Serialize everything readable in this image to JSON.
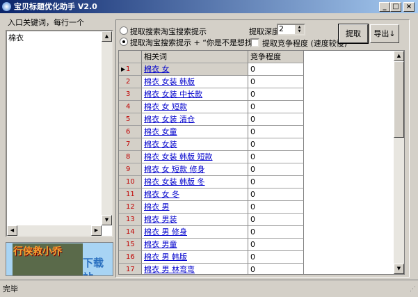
{
  "window": {
    "title": "宝贝标题优化助手 V2.0",
    "minimize": "_",
    "maximize": "□",
    "close": "×"
  },
  "left": {
    "label": "入口关键词，每行一个",
    "keywords": "棉衣",
    "banner_text": "行侠救小乔",
    "banner_side": "下载站"
  },
  "options": {
    "radio1": "提取搜索淘宝搜索提示",
    "radio2": "提取淘宝搜索提示 + “你是不是想找”",
    "selected": 2,
    "depth_label": "提取深度",
    "depth_value": "2",
    "checkbox_label": "提取竞争程度 (速度较慢)",
    "checkbox_checked": false
  },
  "buttons": {
    "extract": "提取",
    "export": "导出↓"
  },
  "grid": {
    "headers": [
      "相关词",
      "竞争程度"
    ],
    "rows": [
      {
        "n": "1",
        "kw": "棉衣 女",
        "v": "0"
      },
      {
        "n": "2",
        "kw": "棉衣 女装 韩版",
        "v": "0"
      },
      {
        "n": "3",
        "kw": "棉衣 女装 中长款",
        "v": "0"
      },
      {
        "n": "4",
        "kw": "棉衣 女 短款",
        "v": "0"
      },
      {
        "n": "5",
        "kw": "棉衣 女装 清仓",
        "v": "0"
      },
      {
        "n": "6",
        "kw": "棉衣 女童",
        "v": "0"
      },
      {
        "n": "7",
        "kw": "棉衣 女装",
        "v": "0"
      },
      {
        "n": "8",
        "kw": "棉衣 女装 韩版 短款",
        "v": "0"
      },
      {
        "n": "9",
        "kw": "棉衣 女 短款 修身",
        "v": "0"
      },
      {
        "n": "10",
        "kw": "棉衣 女装 韩版 冬",
        "v": "0"
      },
      {
        "n": "11",
        "kw": "棉衣 女 冬",
        "v": "0"
      },
      {
        "n": "12",
        "kw": "棉衣 男",
        "v": "0"
      },
      {
        "n": "13",
        "kw": "棉衣 男装",
        "v": "0"
      },
      {
        "n": "14",
        "kw": "棉衣 男 修身",
        "v": "0"
      },
      {
        "n": "15",
        "kw": "棉衣 男童",
        "v": "0"
      },
      {
        "n": "16",
        "kw": "棉衣 男 韩版",
        "v": "0"
      },
      {
        "n": "17",
        "kw": "棉衣 男 林弯弯",
        "v": "0"
      }
    ]
  },
  "status": {
    "text": "完毕"
  }
}
